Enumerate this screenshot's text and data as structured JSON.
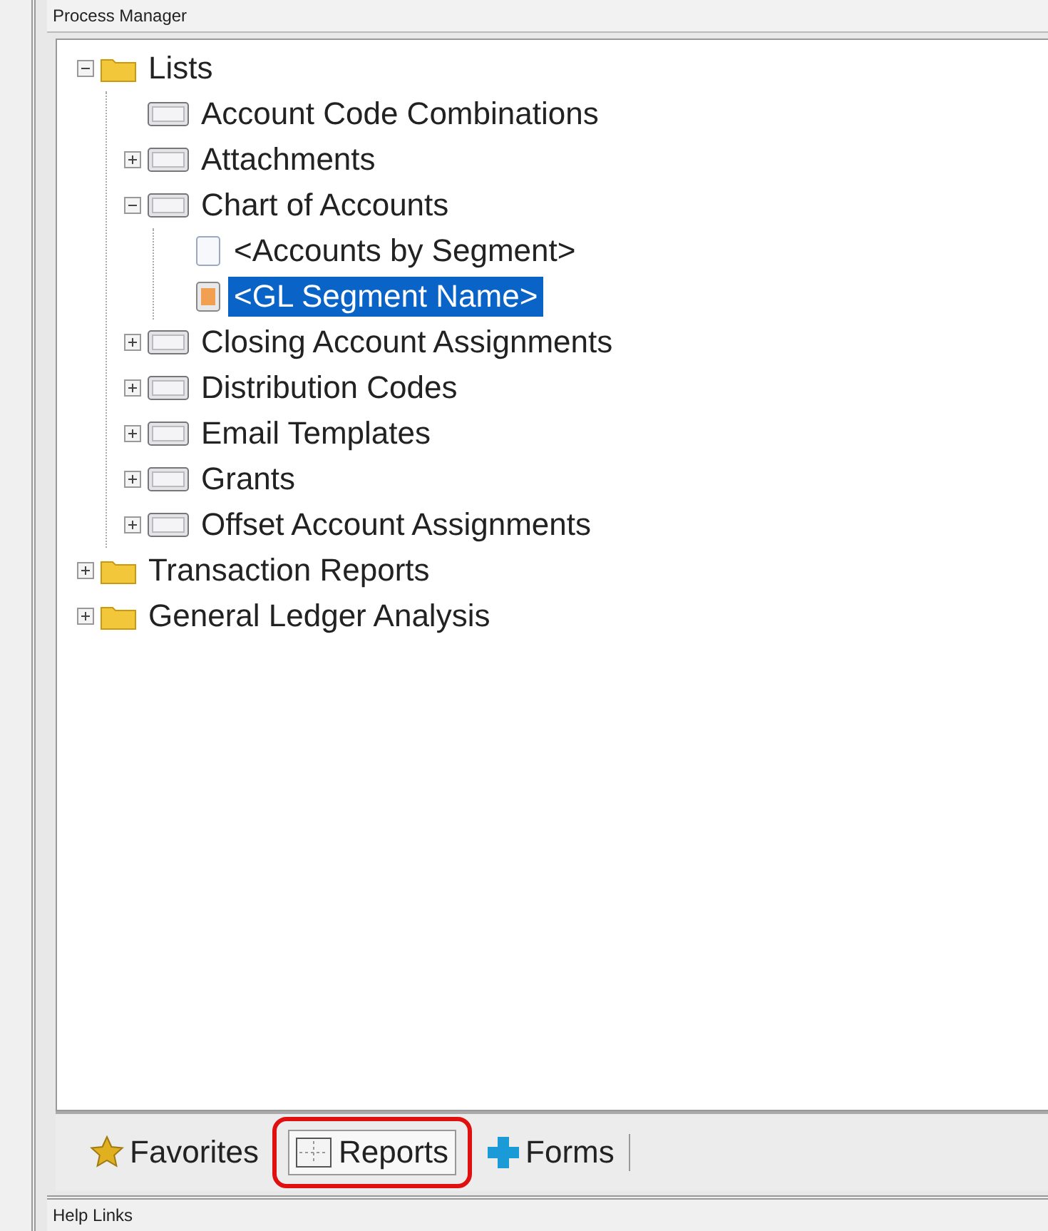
{
  "panel": {
    "title": "Process Manager"
  },
  "tree": [
    {
      "label": "Lists",
      "kind": "folder",
      "expanded": true,
      "selected": false,
      "children": [
        {
          "label": "Account Code Combinations",
          "kind": "list",
          "selected": false
        },
        {
          "label": "Attachments",
          "kind": "list",
          "expanded": false,
          "selected": false
        },
        {
          "label": "Chart of Accounts",
          "kind": "list",
          "expanded": true,
          "selected": false,
          "children": [
            {
              "label": "<Accounts by Segment>",
              "kind": "page",
              "selected": false
            },
            {
              "label": "<GL Segment Name>",
              "kind": "marked",
              "selected": true
            }
          ]
        },
        {
          "label": "Closing Account Assignments",
          "kind": "list",
          "expanded": false,
          "selected": false
        },
        {
          "label": "Distribution Codes",
          "kind": "list",
          "expanded": false,
          "selected": false
        },
        {
          "label": "Email Templates",
          "kind": "list",
          "expanded": false,
          "selected": false
        },
        {
          "label": "Grants",
          "kind": "list",
          "expanded": false,
          "selected": false
        },
        {
          "label": "Offset Account Assignments",
          "kind": "list",
          "expanded": false,
          "selected": false
        }
      ]
    },
    {
      "label": "Transaction Reports",
      "kind": "folder",
      "expanded": false,
      "selected": false
    },
    {
      "label": "General Ledger Analysis",
      "kind": "folder",
      "expanded": false,
      "selected": false
    }
  ],
  "tabs": [
    {
      "label": "Favorites",
      "kind": "star",
      "selected": false,
      "highlighted": false
    },
    {
      "label": "Reports",
      "kind": "report",
      "selected": true,
      "highlighted": true
    },
    {
      "label": "Forms",
      "kind": "plus",
      "selected": false,
      "highlighted": false
    }
  ],
  "help_bar": {
    "title": "Help Links"
  }
}
